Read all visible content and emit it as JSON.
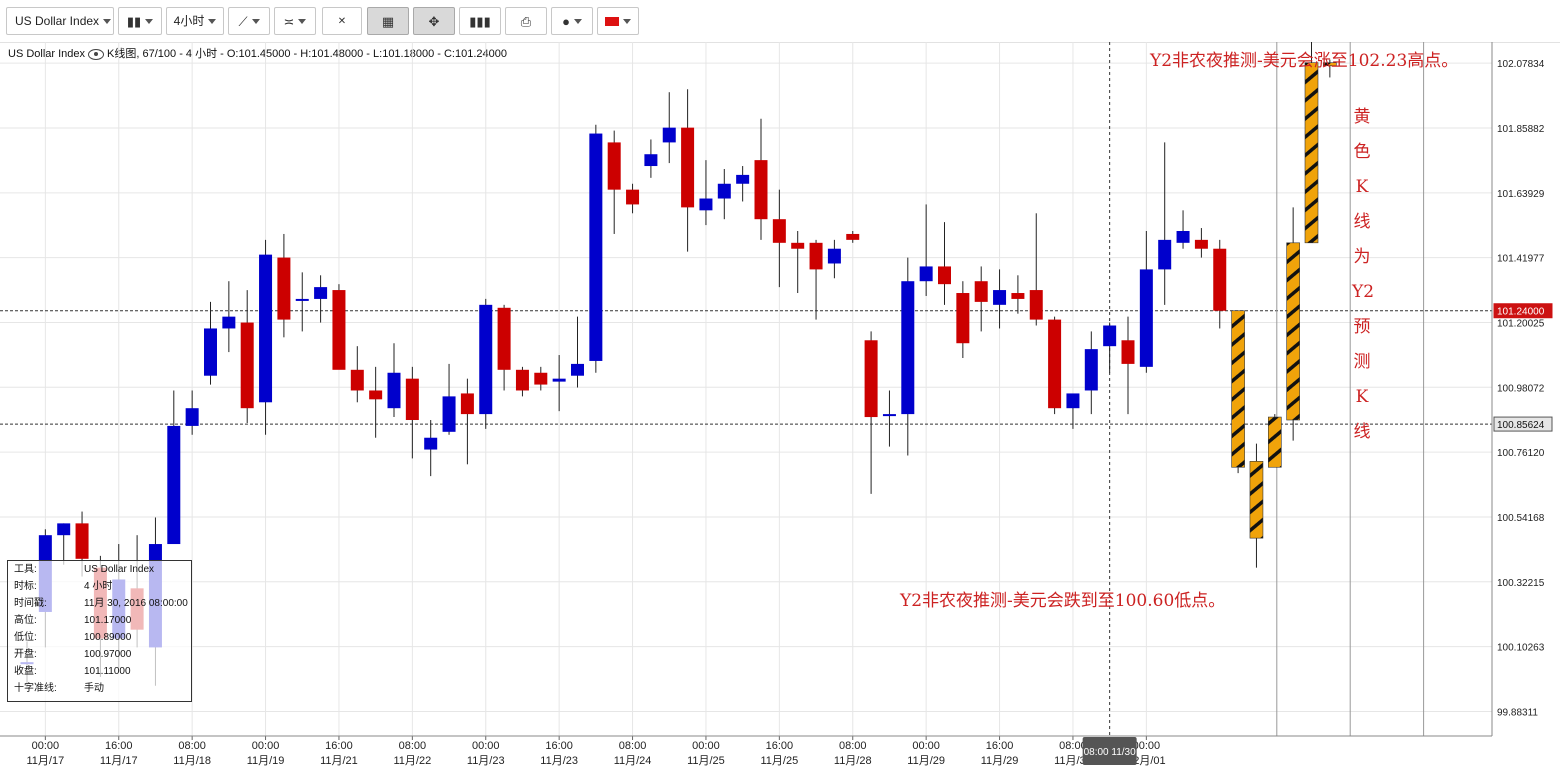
{
  "toolbar": {
    "symbol": "US Dollar Index",
    "timeframe": "4小时",
    "icons": [
      "candle-type-icon",
      "line-tool-icon",
      "compare-icon",
      "clear-all-icon",
      "grid-icon",
      "fullscreen-icon",
      "volume-icon",
      "print-icon",
      "theme-icon",
      "flag-icon"
    ]
  },
  "legend": {
    "symbol": "US Dollar Index",
    "text": "K线图, 67/100 - 4 小时 - O:101.45000 - H:101.48000 - L:101.18000 - C:101.24000"
  },
  "info_panel": {
    "rows": [
      {
        "label": "工具:",
        "value": "US Dollar Index"
      },
      {
        "label": "时标:",
        "value": "4 小时"
      },
      {
        "label": "时间戳:",
        "value": "11月 30, 2016 08:00:00"
      },
      {
        "label": "高位:",
        "value": "101.17000"
      },
      {
        "label": "低位:",
        "value": "100.89000"
      },
      {
        "label": "开盘:",
        "value": "100.97000"
      },
      {
        "label": "收盘:",
        "value": "101.11000"
      },
      {
        "label": "十字准线:",
        "value": "手动"
      }
    ]
  },
  "annotations": {
    "top": "Y2非农夜推测-美元会涨至102.23高点。",
    "bottom": "Y2非农夜推测-美元会跌到至100.60低点。",
    "vertical": [
      "黄",
      "色",
      "K",
      "线",
      "为",
      "Y2",
      "预",
      "测",
      "K",
      "线"
    ]
  },
  "chart_data": {
    "type": "candlestick",
    "colors": {
      "up": "#0000cc",
      "down": "#cc0000",
      "forecast": "#f0a30a",
      "grid": "#e6e6e6"
    },
    "y_ticks": [
      102.07834,
      101.85882,
      101.63929,
      101.41977,
      101.20025,
      100.98072,
      100.7612,
      100.54168,
      100.32215,
      100.10263,
      99.88311
    ],
    "ylim": [
      99.8,
      102.15
    ],
    "price_lines": [
      {
        "value": 101.24,
        "label": "101.24000",
        "highlight": true
      },
      {
        "value": 100.85624,
        "label": "100.85624",
        "highlight": false
      }
    ],
    "crosshair": {
      "time": "08:00 11/30"
    },
    "x_labels": [
      {
        "i": 1,
        "time": "00:00",
        "date": "11月/17"
      },
      {
        "i": 5,
        "time": "16:00",
        "date": "11月/17"
      },
      {
        "i": 9,
        "time": "08:00",
        "date": "11月/18"
      },
      {
        "i": 13,
        "time": "00:00",
        "date": "11月/19"
      },
      {
        "i": 17,
        "time": "16:00",
        "date": "11月/21"
      },
      {
        "i": 21,
        "time": "08:00",
        "date": "11月/22"
      },
      {
        "i": 25,
        "time": "00:00",
        "date": "11月/23"
      },
      {
        "i": 29,
        "time": "16:00",
        "date": "11月/23"
      },
      {
        "i": 33,
        "time": "08:00",
        "date": "11月/24"
      },
      {
        "i": 37,
        "time": "00:00",
        "date": "11月/25"
      },
      {
        "i": 41,
        "time": "16:00",
        "date": "11月/25"
      },
      {
        "i": 45,
        "time": "08:00",
        "date": "11月/28"
      },
      {
        "i": 49,
        "time": "00:00",
        "date": "11月/29"
      },
      {
        "i": 53,
        "time": "16:00",
        "date": "11月/29"
      },
      {
        "i": 57,
        "time": "08:00",
        "date": "11月/30"
      },
      {
        "i": 61,
        "time": "00:00",
        "date": "12月/01"
      }
    ],
    "candles": [
      {
        "o": 100.05,
        "h": 100.12,
        "l": 99.96,
        "c": 100.05
      },
      {
        "o": 100.22,
        "h": 100.5,
        "l": 100.1,
        "c": 100.48
      },
      {
        "o": 100.48,
        "h": 100.52,
        "l": 100.38,
        "c": 100.52
      },
      {
        "o": 100.52,
        "h": 100.56,
        "l": 100.34,
        "c": 100.4
      },
      {
        "o": 100.37,
        "h": 100.41,
        "l": 100.0,
        "c": 100.13
      },
      {
        "o": 100.13,
        "h": 100.45,
        "l": 100.03,
        "c": 100.33
      },
      {
        "o": 100.3,
        "h": 100.48,
        "l": 100.1,
        "c": 100.16
      },
      {
        "o": 100.1,
        "h": 100.54,
        "l": 99.97,
        "c": 100.45
      },
      {
        "o": 100.45,
        "h": 100.97,
        "l": 100.45,
        "c": 100.85
      },
      {
        "o": 100.85,
        "h": 100.97,
        "l": 100.82,
        "c": 100.91
      },
      {
        "o": 101.02,
        "h": 101.27,
        "l": 100.99,
        "c": 101.18
      },
      {
        "o": 101.18,
        "h": 101.34,
        "l": 101.1,
        "c": 101.22
      },
      {
        "o": 101.2,
        "h": 101.31,
        "l": 100.86,
        "c": 100.91
      },
      {
        "o": 100.93,
        "h": 101.48,
        "l": 100.82,
        "c": 101.43
      },
      {
        "o": 101.42,
        "h": 101.5,
        "l": 101.15,
        "c": 101.21
      },
      {
        "o": 101.28,
        "h": 101.37,
        "l": 101.17,
        "c": 101.28
      },
      {
        "o": 101.28,
        "h": 101.36,
        "l": 101.2,
        "c": 101.32
      },
      {
        "o": 101.31,
        "h": 101.33,
        "l": 101.07,
        "c": 101.04
      },
      {
        "o": 101.04,
        "h": 101.12,
        "l": 100.93,
        "c": 100.97
      },
      {
        "o": 100.97,
        "h": 101.05,
        "l": 100.81,
        "c": 100.94
      },
      {
        "o": 100.91,
        "h": 101.13,
        "l": 100.88,
        "c": 101.03
      },
      {
        "o": 101.01,
        "h": 101.05,
        "l": 100.74,
        "c": 100.87
      },
      {
        "o": 100.77,
        "h": 100.87,
        "l": 100.68,
        "c": 100.81
      },
      {
        "o": 100.83,
        "h": 101.06,
        "l": 100.82,
        "c": 100.95
      },
      {
        "o": 100.96,
        "h": 101.01,
        "l": 100.72,
        "c": 100.89
      },
      {
        "o": 100.89,
        "h": 101.28,
        "l": 100.84,
        "c": 101.26
      },
      {
        "o": 101.25,
        "h": 101.26,
        "l": 100.97,
        "c": 101.04
      },
      {
        "o": 101.04,
        "h": 101.05,
        "l": 100.95,
        "c": 100.97
      },
      {
        "o": 101.03,
        "h": 101.05,
        "l": 100.97,
        "c": 100.99
      },
      {
        "o": 101.0,
        "h": 101.09,
        "l": 100.9,
        "c": 101.01
      },
      {
        "o": 101.02,
        "h": 101.22,
        "l": 100.98,
        "c": 101.06
      },
      {
        "o": 101.07,
        "h": 101.87,
        "l": 101.03,
        "c": 101.84
      },
      {
        "o": 101.81,
        "h": 101.85,
        "l": 101.5,
        "c": 101.65
      },
      {
        "o": 101.65,
        "h": 101.67,
        "l": 101.57,
        "c": 101.6
      },
      {
        "o": 101.73,
        "h": 101.82,
        "l": 101.69,
        "c": 101.77
      },
      {
        "o": 101.81,
        "h": 101.98,
        "l": 101.74,
        "c": 101.86
      },
      {
        "o": 101.86,
        "h": 101.99,
        "l": 101.44,
        "c": 101.59
      },
      {
        "o": 101.58,
        "h": 101.75,
        "l": 101.53,
        "c": 101.62
      },
      {
        "o": 101.62,
        "h": 101.72,
        "l": 101.55,
        "c": 101.67
      },
      {
        "o": 101.67,
        "h": 101.73,
        "l": 101.61,
        "c": 101.7
      },
      {
        "o": 101.75,
        "h": 101.89,
        "l": 101.48,
        "c": 101.55
      },
      {
        "o": 101.55,
        "h": 101.65,
        "l": 101.32,
        "c": 101.47
      },
      {
        "o": 101.47,
        "h": 101.51,
        "l": 101.3,
        "c": 101.45
      },
      {
        "o": 101.47,
        "h": 101.48,
        "l": 101.21,
        "c": 101.38
      },
      {
        "o": 101.4,
        "h": 101.48,
        "l": 101.35,
        "c": 101.45
      },
      {
        "o": 101.5,
        "h": 101.51,
        "l": 101.47,
        "c": 101.48
      },
      {
        "o": 101.14,
        "h": 101.17,
        "l": 100.62,
        "c": 100.88
      },
      {
        "o": 100.89,
        "h": 100.97,
        "l": 100.78,
        "c": 100.89
      },
      {
        "o": 100.89,
        "h": 101.42,
        "l": 100.75,
        "c": 101.34
      },
      {
        "o": 101.34,
        "h": 101.6,
        "l": 101.29,
        "c": 101.39
      },
      {
        "o": 101.39,
        "h": 101.54,
        "l": 101.26,
        "c": 101.33
      },
      {
        "o": 101.3,
        "h": 101.34,
        "l": 101.08,
        "c": 101.13
      },
      {
        "o": 101.34,
        "h": 101.39,
        "l": 101.17,
        "c": 101.27
      },
      {
        "o": 101.26,
        "h": 101.38,
        "l": 101.18,
        "c": 101.31
      },
      {
        "o": 101.3,
        "h": 101.36,
        "l": 101.23,
        "c": 101.28
      },
      {
        "o": 101.31,
        "h": 101.57,
        "l": 101.19,
        "c": 101.21
      },
      {
        "o": 101.21,
        "h": 101.22,
        "l": 100.89,
        "c": 100.91
      },
      {
        "o": 100.91,
        "h": 100.94,
        "l": 100.84,
        "c": 100.96
      },
      {
        "o": 100.97,
        "h": 101.17,
        "l": 100.89,
        "c": 101.11
      },
      {
        "o": 101.12,
        "h": 101.2,
        "l": 101.03,
        "c": 101.19
      },
      {
        "o": 101.14,
        "h": 101.22,
        "l": 100.89,
        "c": 101.06
      },
      {
        "o": 101.05,
        "h": 101.51,
        "l": 101.03,
        "c": 101.38
      },
      {
        "o": 101.38,
        "h": 101.81,
        "l": 101.26,
        "c": 101.48
      },
      {
        "o": 101.47,
        "h": 101.58,
        "l": 101.45,
        "c": 101.51
      },
      {
        "o": 101.48,
        "h": 101.52,
        "l": 101.42,
        "c": 101.45
      },
      {
        "o": 101.45,
        "h": 101.48,
        "l": 101.18,
        "c": 101.24
      }
    ],
    "forecast": [
      {
        "o": 101.24,
        "h": 101.24,
        "l": 100.69,
        "c": 100.71
      },
      {
        "o": 100.73,
        "h": 100.79,
        "l": 100.37,
        "c": 100.47
      },
      {
        "o": 100.71,
        "h": 100.89,
        "l": 100.71,
        "c": 100.88
      },
      {
        "o": 100.87,
        "h": 101.59,
        "l": 100.8,
        "c": 101.47
      },
      {
        "o": 101.47,
        "h": 102.23,
        "l": 101.47,
        "c": 102.08
      },
      {
        "o": 102.07,
        "h": 102.09,
        "l": 102.03,
        "c": 102.08
      }
    ]
  }
}
